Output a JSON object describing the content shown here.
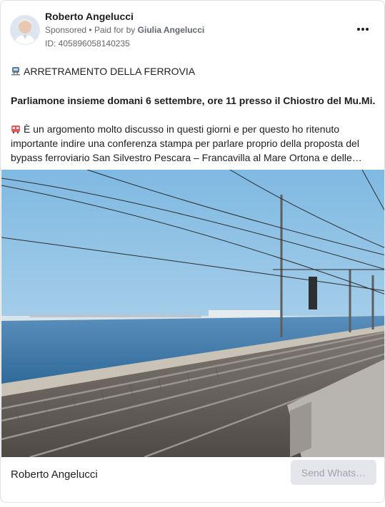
{
  "post": {
    "author": "Roberto Angelucci",
    "sponsored": "Sponsored",
    "paid_prefix": "Paid for by",
    "payer": "Giulia Angelucci",
    "library_id": "ID: 405896058140235",
    "headline": "ARRETRAMENTO DELLA FERROVIA",
    "bold_line": "Parliamone insieme domani 6 settembre, ore 11 presso il Chiostro del Mu.Mi.",
    "body_line1": "È un argomento molto discusso in questi giorni e per questo ho ritenuto",
    "body_line2": "importante indire una conferenza stampa per parlare proprio della proposta del",
    "body_line3": "bypass ferroviario San Silvestro Pescara – Francavilla al Mare Ortona e delle…"
  },
  "footer": {
    "page_name": "Roberto Angelucci",
    "cta_label": "Send Whats…"
  },
  "icons": {
    "more": "more-options-icon",
    "headline_emoji": "railway-track-emoji",
    "body_emoji": "train-emoji"
  },
  "colors": {
    "sky": "#8fc3e6",
    "sea": "#3f79a8",
    "muted_text": "#65676b",
    "button_bg": "#e4e6eb"
  }
}
